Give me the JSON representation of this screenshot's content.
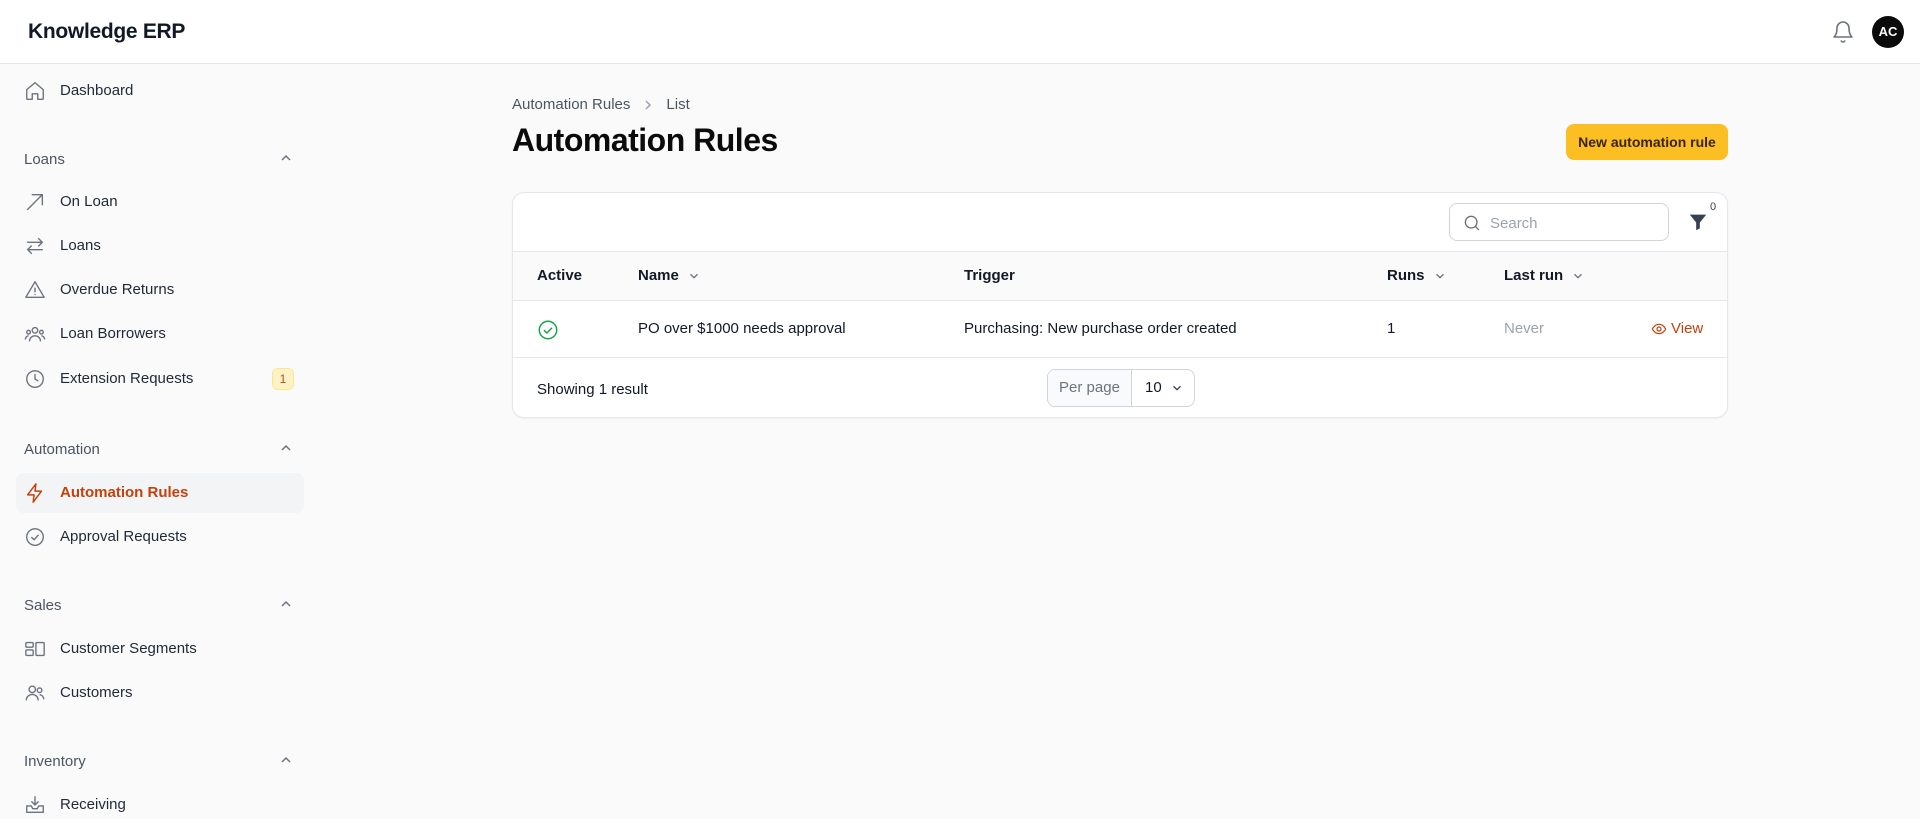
{
  "app": {
    "title": "Knowledge ERP",
    "user_initials": "AC"
  },
  "sidebar": {
    "dashboard": "Dashboard",
    "groups": {
      "loans": {
        "label": "Loans",
        "items": [
          "On Loan",
          "Loans",
          "Overdue Returns",
          "Loan Borrowers",
          "Extension Requests"
        ],
        "extension_badge": "1"
      },
      "automation": {
        "label": "Automation",
        "items": [
          "Automation Rules",
          "Approval Requests"
        ]
      },
      "sales": {
        "label": "Sales",
        "items": [
          "Customer Segments",
          "Customers"
        ]
      },
      "inventory": {
        "label": "Inventory",
        "items": [
          "Receiving"
        ]
      }
    }
  },
  "breadcrumb": {
    "root": "Automation Rules",
    "current": "List"
  },
  "page": {
    "title": "Automation Rules",
    "new_button": "New automation rule"
  },
  "table": {
    "search_placeholder": "Search",
    "filter_count": "0",
    "columns": {
      "active": "Active",
      "name": "Name",
      "trigger": "Trigger",
      "runs": "Runs",
      "last_run": "Last run"
    },
    "rows": [
      {
        "active": true,
        "name": "PO over $1000 needs approval",
        "trigger": "Purchasing: New purchase order created",
        "runs": "1",
        "last_run": "Never",
        "action": "View"
      }
    ],
    "result_text": "Showing 1 result",
    "per_page_label": "Per page",
    "per_page_value": "10"
  },
  "colors": {
    "accent": "#c2410c",
    "primary_button": "#fbbf24",
    "success": "#16a34a"
  }
}
